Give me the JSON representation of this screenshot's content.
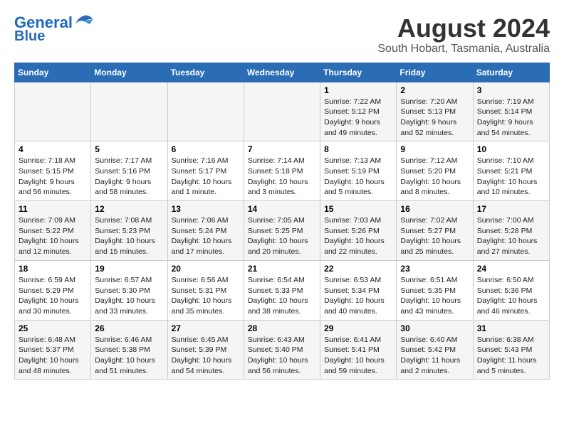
{
  "logo": {
    "part1": "General",
    "part2": "Blue"
  },
  "title": {
    "month_year": "August 2024",
    "location": "South Hobart, Tasmania, Australia"
  },
  "days_of_week": [
    "Sunday",
    "Monday",
    "Tuesday",
    "Wednesday",
    "Thursday",
    "Friday",
    "Saturday"
  ],
  "weeks": [
    [
      {
        "day": "",
        "info": ""
      },
      {
        "day": "",
        "info": ""
      },
      {
        "day": "",
        "info": ""
      },
      {
        "day": "",
        "info": ""
      },
      {
        "day": "1",
        "info": "Sunrise: 7:22 AM\nSunset: 5:12 PM\nDaylight: 9 hours\nand 49 minutes."
      },
      {
        "day": "2",
        "info": "Sunrise: 7:20 AM\nSunset: 5:13 PM\nDaylight: 9 hours\nand 52 minutes."
      },
      {
        "day": "3",
        "info": "Sunrise: 7:19 AM\nSunset: 5:14 PM\nDaylight: 9 hours\nand 54 minutes."
      }
    ],
    [
      {
        "day": "4",
        "info": "Sunrise: 7:18 AM\nSunset: 5:15 PM\nDaylight: 9 hours\nand 56 minutes."
      },
      {
        "day": "5",
        "info": "Sunrise: 7:17 AM\nSunset: 5:16 PM\nDaylight: 9 hours\nand 58 minutes."
      },
      {
        "day": "6",
        "info": "Sunrise: 7:16 AM\nSunset: 5:17 PM\nDaylight: 10 hours\nand 1 minute."
      },
      {
        "day": "7",
        "info": "Sunrise: 7:14 AM\nSunset: 5:18 PM\nDaylight: 10 hours\nand 3 minutes."
      },
      {
        "day": "8",
        "info": "Sunrise: 7:13 AM\nSunset: 5:19 PM\nDaylight: 10 hours\nand 5 minutes."
      },
      {
        "day": "9",
        "info": "Sunrise: 7:12 AM\nSunset: 5:20 PM\nDaylight: 10 hours\nand 8 minutes."
      },
      {
        "day": "10",
        "info": "Sunrise: 7:10 AM\nSunset: 5:21 PM\nDaylight: 10 hours\nand 10 minutes."
      }
    ],
    [
      {
        "day": "11",
        "info": "Sunrise: 7:09 AM\nSunset: 5:22 PM\nDaylight: 10 hours\nand 12 minutes."
      },
      {
        "day": "12",
        "info": "Sunrise: 7:08 AM\nSunset: 5:23 PM\nDaylight: 10 hours\nand 15 minutes."
      },
      {
        "day": "13",
        "info": "Sunrise: 7:06 AM\nSunset: 5:24 PM\nDaylight: 10 hours\nand 17 minutes."
      },
      {
        "day": "14",
        "info": "Sunrise: 7:05 AM\nSunset: 5:25 PM\nDaylight: 10 hours\nand 20 minutes."
      },
      {
        "day": "15",
        "info": "Sunrise: 7:03 AM\nSunset: 5:26 PM\nDaylight: 10 hours\nand 22 minutes."
      },
      {
        "day": "16",
        "info": "Sunrise: 7:02 AM\nSunset: 5:27 PM\nDaylight: 10 hours\nand 25 minutes."
      },
      {
        "day": "17",
        "info": "Sunrise: 7:00 AM\nSunset: 5:28 PM\nDaylight: 10 hours\nand 27 minutes."
      }
    ],
    [
      {
        "day": "18",
        "info": "Sunrise: 6:59 AM\nSunset: 5:29 PM\nDaylight: 10 hours\nand 30 minutes."
      },
      {
        "day": "19",
        "info": "Sunrise: 6:57 AM\nSunset: 5:30 PM\nDaylight: 10 hours\nand 33 minutes."
      },
      {
        "day": "20",
        "info": "Sunrise: 6:56 AM\nSunset: 5:31 PM\nDaylight: 10 hours\nand 35 minutes."
      },
      {
        "day": "21",
        "info": "Sunrise: 6:54 AM\nSunset: 5:33 PM\nDaylight: 10 hours\nand 38 minutes."
      },
      {
        "day": "22",
        "info": "Sunrise: 6:53 AM\nSunset: 5:34 PM\nDaylight: 10 hours\nand 40 minutes."
      },
      {
        "day": "23",
        "info": "Sunrise: 6:51 AM\nSunset: 5:35 PM\nDaylight: 10 hours\nand 43 minutes."
      },
      {
        "day": "24",
        "info": "Sunrise: 6:50 AM\nSunset: 5:36 PM\nDaylight: 10 hours\nand 46 minutes."
      }
    ],
    [
      {
        "day": "25",
        "info": "Sunrise: 6:48 AM\nSunset: 5:37 PM\nDaylight: 10 hours\nand 48 minutes."
      },
      {
        "day": "26",
        "info": "Sunrise: 6:46 AM\nSunset: 5:38 PM\nDaylight: 10 hours\nand 51 minutes."
      },
      {
        "day": "27",
        "info": "Sunrise: 6:45 AM\nSunset: 5:39 PM\nDaylight: 10 hours\nand 54 minutes."
      },
      {
        "day": "28",
        "info": "Sunrise: 6:43 AM\nSunset: 5:40 PM\nDaylight: 10 hours\nand 56 minutes."
      },
      {
        "day": "29",
        "info": "Sunrise: 6:41 AM\nSunset: 5:41 PM\nDaylight: 10 hours\nand 59 minutes."
      },
      {
        "day": "30",
        "info": "Sunrise: 6:40 AM\nSunset: 5:42 PM\nDaylight: 11 hours\nand 2 minutes."
      },
      {
        "day": "31",
        "info": "Sunrise: 6:38 AM\nSunset: 5:43 PM\nDaylight: 11 hours\nand 5 minutes."
      }
    ]
  ]
}
